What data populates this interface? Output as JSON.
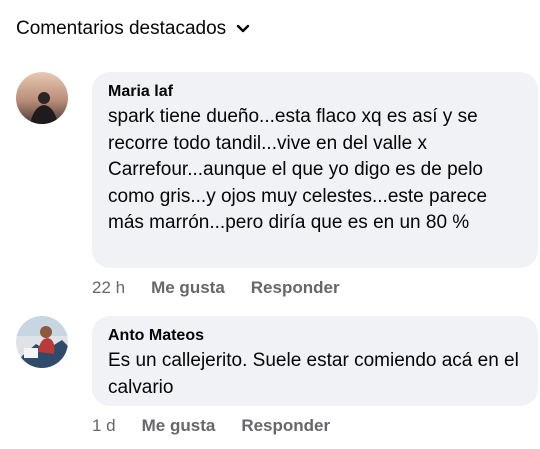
{
  "header": {
    "title": "Comentarios destacados"
  },
  "comments": [
    {
      "author": "Maria laf",
      "text": "spark tiene dueño...esta flaco xq es así y se recorre todo tandil...vive en del valle x Carrefour...aunque el que yo digo es de pelo como gris...y ojos muy celestes...este parece más marrón...pero diría que es en un 80 %",
      "time": "22 h",
      "like_label": "Me gusta",
      "reply_label": "Responder"
    },
    {
      "author": "Anto Mateos",
      "text": "Es un callejerito. Suele estar comiendo acá en el calvario",
      "time": "1 d",
      "like_label": "Me gusta",
      "reply_label": "Responder"
    }
  ],
  "colors": {
    "bubble": "#f0f2f5",
    "secondary_text": "#65676b"
  }
}
